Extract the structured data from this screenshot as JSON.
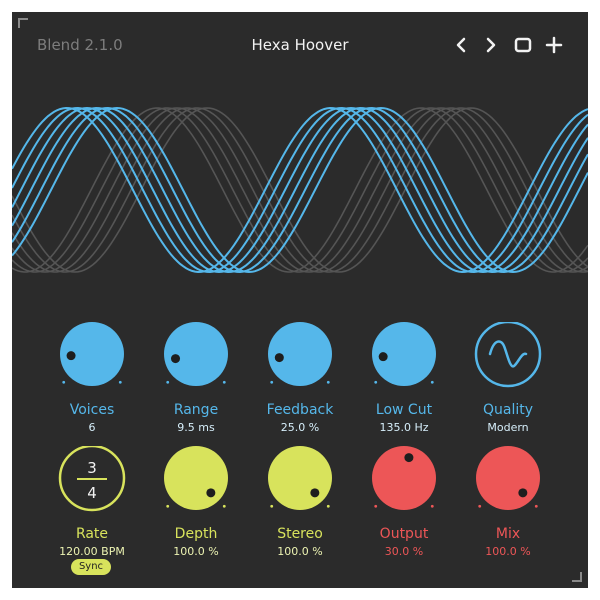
{
  "header": {
    "version": "Blend 2.1.0",
    "preset_name": "Hexa Hoover",
    "icons": [
      "chevron-left-icon",
      "chevron-right-icon",
      "window-icon",
      "plus-icon"
    ]
  },
  "colors": {
    "background": "#2b2b2b",
    "blue": "#55b7ea",
    "lime": "#d8e35c",
    "red": "#ed5657",
    "wave_dim": "#555555"
  },
  "controls": {
    "voices": {
      "label": "Voices",
      "value": "6",
      "level": 0.15
    },
    "range": {
      "label": "Range",
      "value": "9.5 ms",
      "level": 0.12
    },
    "feedback": {
      "label": "Feedback",
      "value": "25.0 %",
      "level": 0.13
    },
    "lowcut": {
      "label": "Low Cut",
      "value": "135.0 Hz",
      "level": 0.14
    },
    "quality": {
      "label": "Quality",
      "value": "Modern"
    },
    "rate": {
      "label": "Rate",
      "value": "120.00 BPM",
      "numerator": "3",
      "denominator": "4",
      "sync_label": "Sync"
    },
    "depth": {
      "label": "Depth",
      "value": "100.0 %",
      "level": 1.0
    },
    "stereo": {
      "label": "Stereo",
      "value": "100.0 %",
      "level": 1.0
    },
    "output": {
      "label": "Output",
      "value": "30.0 %",
      "level": 0.55
    },
    "mix": {
      "label": "Mix",
      "value": "100.0 %",
      "level": 1.0
    }
  }
}
